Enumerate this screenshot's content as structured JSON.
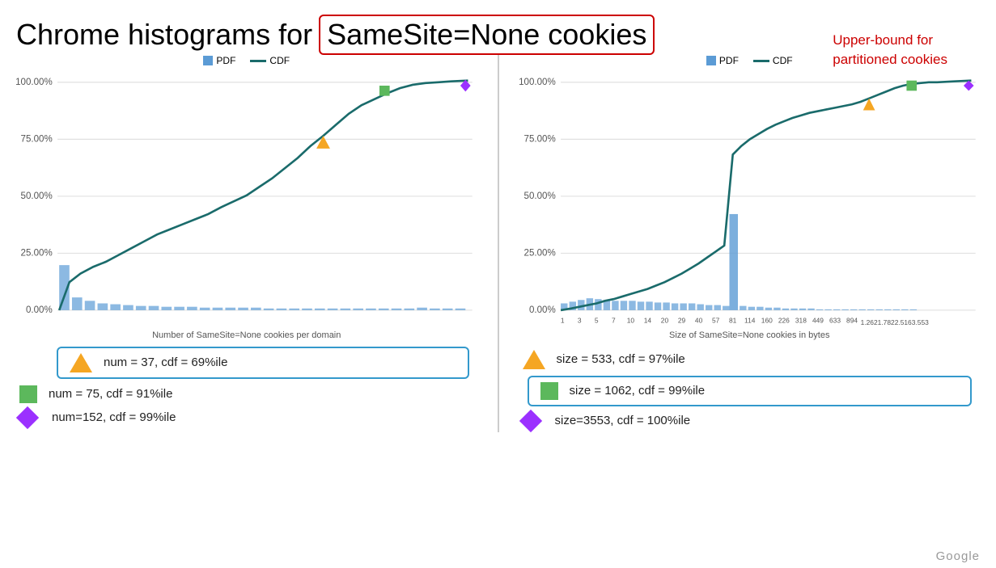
{
  "title": {
    "prefix": "Chrome histograms for",
    "highlight": "SameSite=None cookies",
    "annotation_line1": "Upper-bound for",
    "annotation_line2": "partitioned cookies"
  },
  "left_chart": {
    "legend": {
      "pdf": "PDF",
      "cdf": "CDF"
    },
    "y_labels": [
      "100.00%",
      "75.00%",
      "50.00%",
      "25.00%",
      "0.00%"
    ],
    "chart_label": "Number of SameSite=None cookies per domain",
    "stats": [
      {
        "shape": "triangle",
        "color": "orange",
        "text": "num = 37, cdf = 69%ile",
        "highlighted": true
      },
      {
        "shape": "square",
        "color": "green",
        "text": "num = 75, cdf = 91%ile",
        "highlighted": false
      },
      {
        "shape": "diamond",
        "color": "purple",
        "text": "num=152, cdf = 99%ile",
        "highlighted": false
      }
    ]
  },
  "right_chart": {
    "legend": {
      "pdf": "PDF",
      "cdf": "CDF"
    },
    "y_labels": [
      "100.00%",
      "75.00%",
      "50.00%",
      "25.00%",
      "0.00%"
    ],
    "x_labels": [
      "1",
      "3",
      "5",
      "7",
      "10",
      "14",
      "20",
      "29",
      "40",
      "57",
      "81",
      "114",
      "160",
      "226",
      "318",
      "449",
      "633",
      "894",
      "1,262",
      "1,782",
      "2,516",
      "3,553"
    ],
    "chart_label": "Size of SameSite=None cookies in bytes",
    "stats": [
      {
        "shape": "triangle",
        "color": "orange",
        "text": "size = 533, cdf = 97%ile",
        "highlighted": false
      },
      {
        "shape": "square",
        "color": "green",
        "text": "size = 1062, cdf = 99%ile",
        "highlighted": true
      },
      {
        "shape": "diamond",
        "color": "purple",
        "text": "size=3553, cdf = 100%ile",
        "highlighted": false
      }
    ]
  },
  "google_label": "Google"
}
